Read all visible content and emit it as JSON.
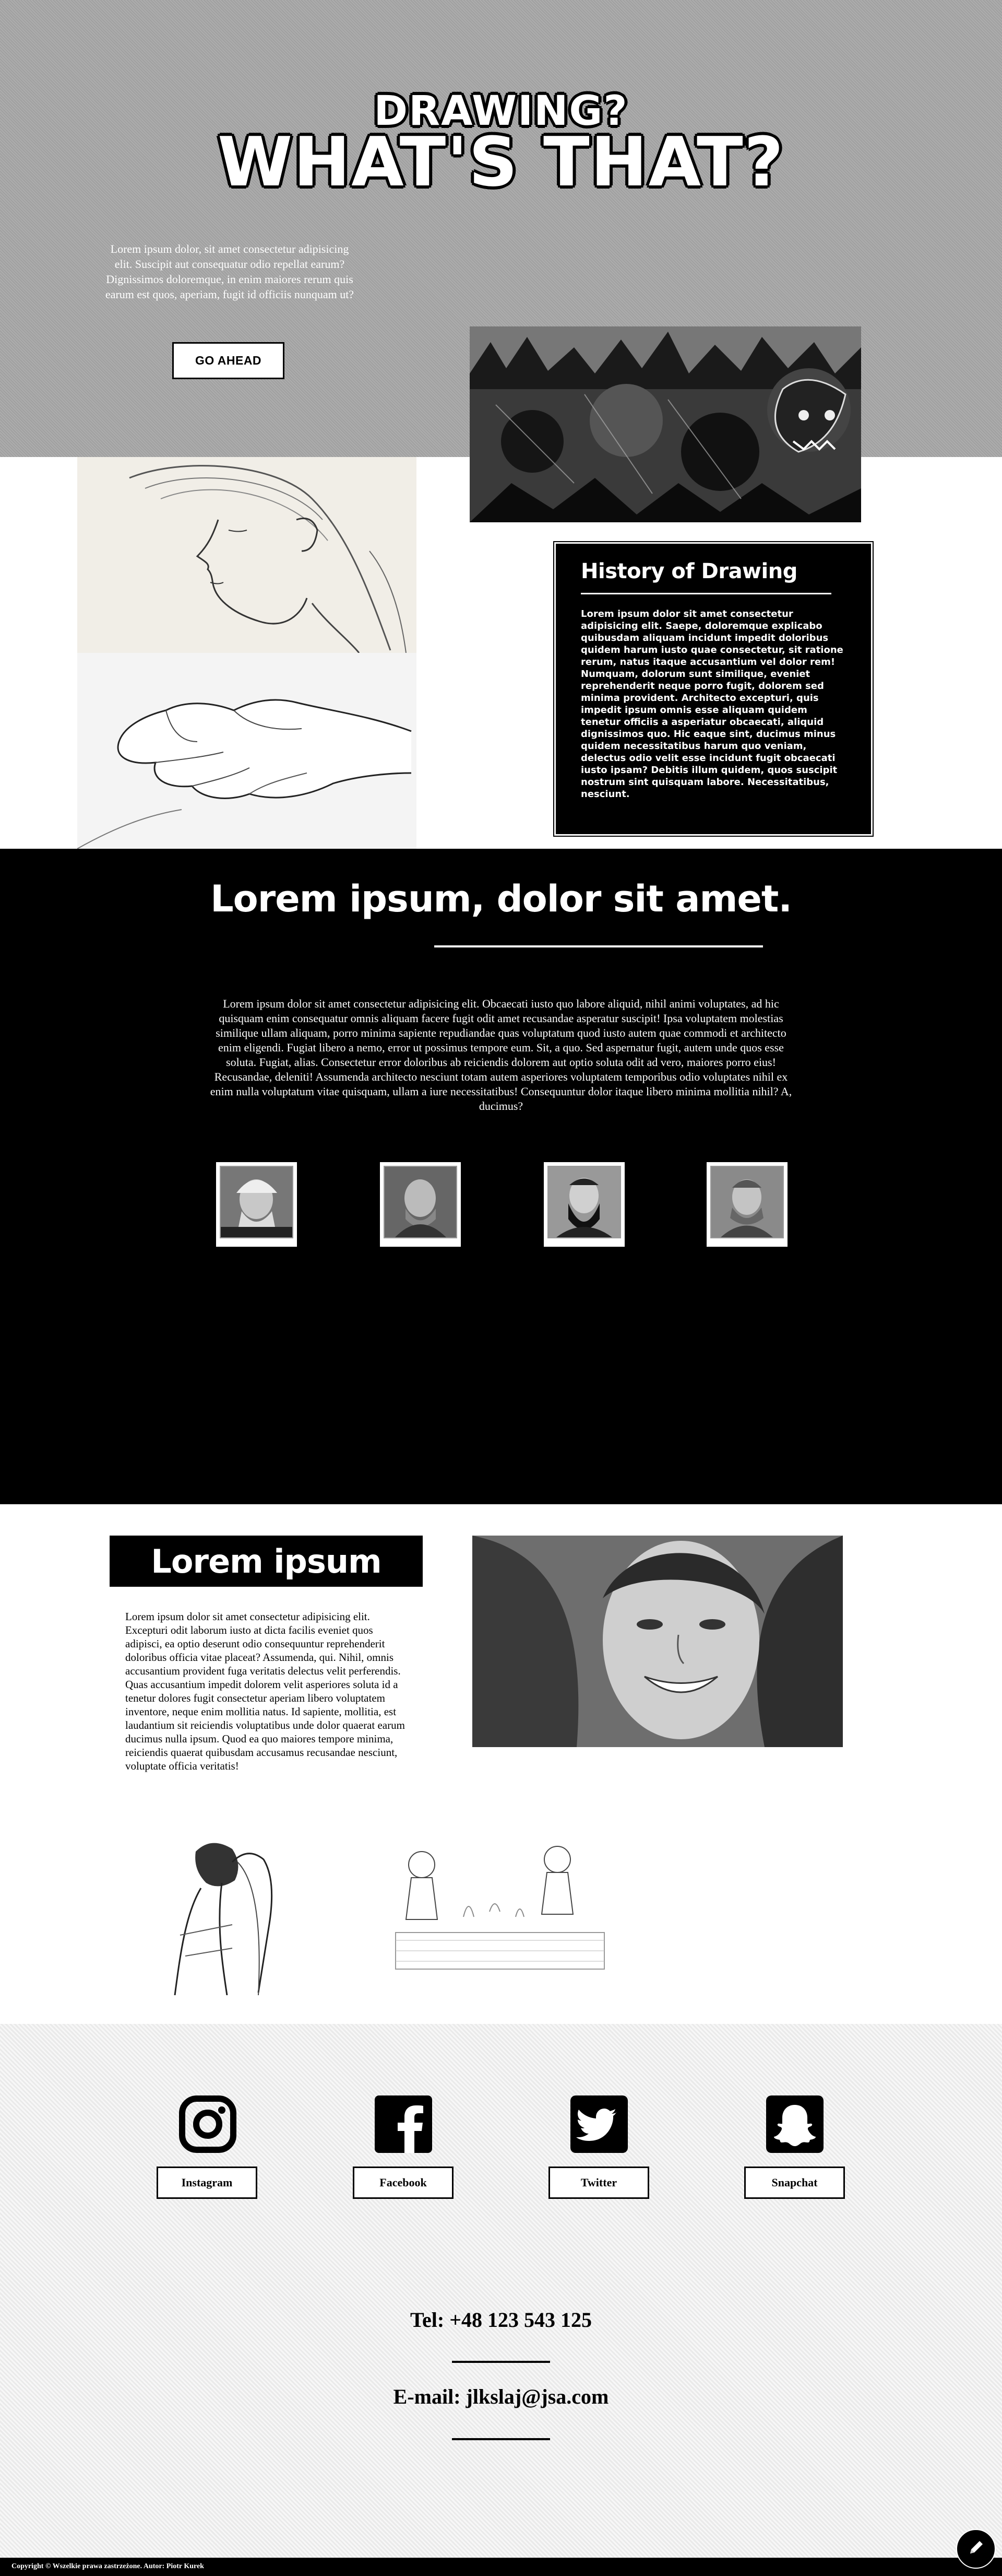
{
  "hero": {
    "subtitle": "DRAWING?",
    "title": "WHAT'S THAT?",
    "text": "Lorem ipsum dolor, sit amet consectetur adipisicing elit. Suscipit aut consequatur odio repellat earum? Dignissimos doloremque, in enim maiores rerum quis earum est quos, aperiam, fugit id officiis nunquam ut?",
    "button": "GO AHEAD"
  },
  "history": {
    "title": "History of Drawing",
    "text": "Lorem ipsum dolor sit amet consectetur adipisicing elit. Saepe, doloremque explicabo quibusdam aliquam incidunt impedit doloribus quidem harum iusto quae consectetur, sit ratione rerum, natus itaque accusantium vel dolor rem! Numquam, dolorum sunt similique, eveniet reprehenderit neque porro fugit, dolorem sed minima provident. Architecto excepturi, quis impedit ipsum omnis esse aliquam quidem tenetur officiis a asperiatur obcaecati, aliquid dignissimos quo. Hic eaque sint, ducimus minus quidem necessitatibus harum quo veniam, delectus odio velit esse incidunt fugit obcaecati iusto ipsam? Debitis illum quidem, quos suscipit nostrum sint quisquam labore. Necessitatibus, nesciunt."
  },
  "black_section": {
    "title": "Lorem ipsum, dolor sit amet.",
    "text": "Lorem ipsum dolor sit amet consectetur adipisicing elit. Obcaecati iusto quo labore aliquid, nihil animi voluptates, ad hic quisquam enim consequatur omnis aliquam facere fugit odit amet recusandae asperatur suscipit! Ipsa voluptatem molestias similique ullam aliquam, porro minima sapiente repudiandae quas voluptatum quod iusto autem quae commodi et architecto enim eligendi. Fugiat libero a nemo, error ut possimus tempore eum. Sit, a quo. Sed aspernatur fugit, autem unde quos esse soluta. Fugiat, alias. Consectetur error doloribus ab reiciendis dolorem aut optio soluta odit ad vero, maiores porro eius! Recusandae, deleniti! Assumenda architecto nesciunt totam autem asperiores voluptatem temporibus odio voluptates nihil ex enim nulla voluptatum vitae quisquam, ullam a iure necessitatibus! Consequuntur dolor itaque libero minima mollitia nihil? A, ducimus?"
  },
  "lorem_section": {
    "title": "Lorem ipsum",
    "text": "Lorem ipsum dolor sit amet consectetur adipisicing elit. Excepturi odit laborum iusto at dicta facilis eveniet quos adipisci, ea optio deserunt odio consequuntur reprehenderit doloribus officia vitae placeat? Assumenda, qui. Nihil, omnis accusantium provident fuga veritatis delectus velit perferendis. Quas accusantium impedit dolorem velit asperiores soluta id a tenetur dolores fugit consectetur aperiam libero voluptatem inventore, neque enim mollitia natus. Id sapiente, mollitia, est laudantium sit reiciendis voluptatibus unde dolor quaerat earum ducimus nulla ipsum. Quod ea quo maiores tempore minima, reiciendis quaerat quibusdam accusamus recusandae nesciunt, voluptate officia veritatis!"
  },
  "social": {
    "instagram": "Instagram",
    "facebook": "Facebook",
    "twitter": "Twitter",
    "snapchat": "Snapchat"
  },
  "contact": {
    "phone": "Tel: +48 123 543 125",
    "email": "E-mail: jlkslaj@jsa.com"
  },
  "footer": {
    "text": "Copyright © Wszelkie prawa zastrzeżone. Autor: Piotr Kurek"
  },
  "icons": [
    "instagram-icon",
    "facebook-icon",
    "twitter-icon",
    "snapchat-icon",
    "pencil-icon"
  ]
}
